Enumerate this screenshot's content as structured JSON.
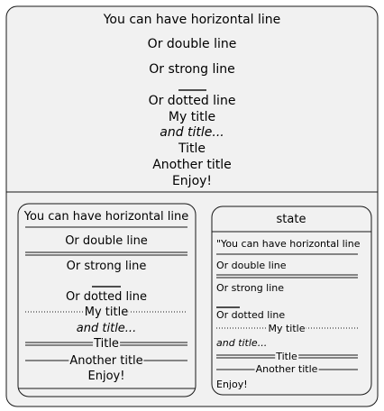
{
  "outer": {
    "lines": [
      "You can have horizontal line",
      "Or double line",
      "Or strong line",
      "Or dotted line",
      "My title",
      "and title...",
      "Title",
      "Another title",
      "Enjoy!"
    ]
  },
  "left_state": {
    "title": "You can have horizontal line",
    "lines": [
      "Or double line",
      "Or strong line",
      "Or dotted line",
      "My title",
      "and title...",
      "Title",
      "Another title",
      "Enjoy!"
    ]
  },
  "right_state": {
    "title": "state",
    "lines": [
      "\"You can have horizontal line",
      "Or double line",
      "Or strong line",
      "Or dotted line",
      "My title",
      "and title...",
      "Title",
      "Another title",
      "Enjoy!"
    ]
  },
  "colors": {
    "fill": "#f1f1f1",
    "stroke": "#181818"
  }
}
